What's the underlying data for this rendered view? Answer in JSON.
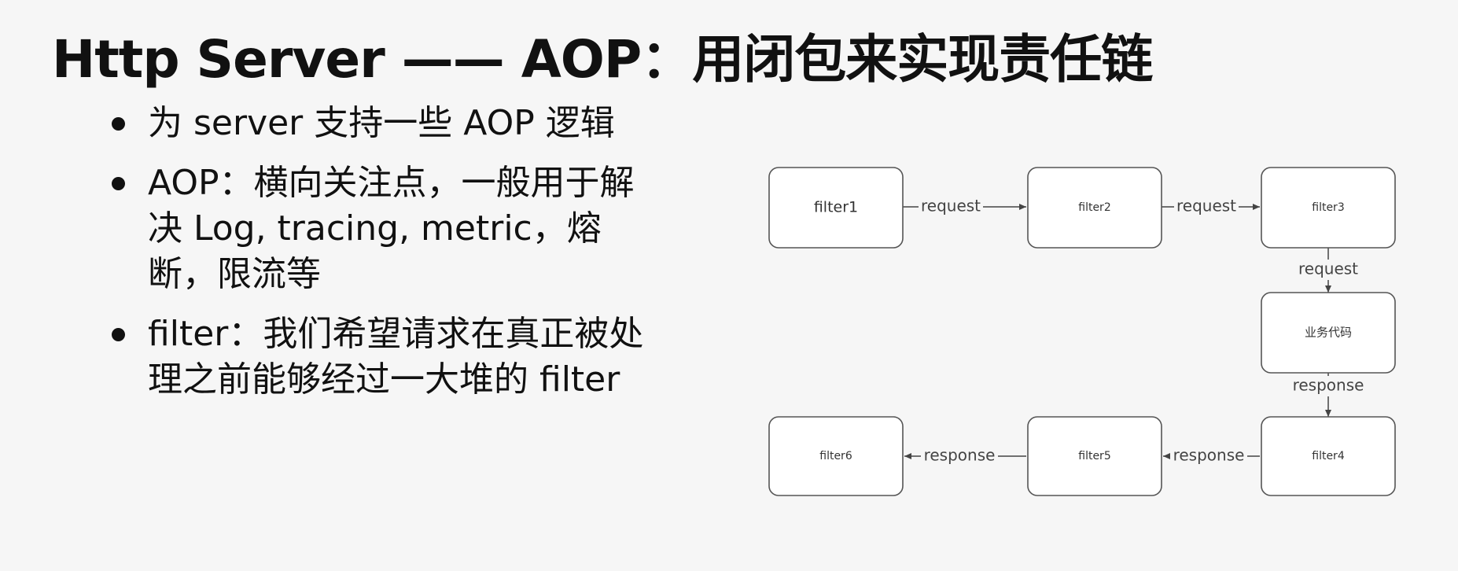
{
  "title": "Http Server —— AOP：用闭包来实现责任链",
  "bullets": [
    "为 server 支持一些 AOP 逻辑",
    "AOP：横向关注点，一般用于解决 Log, tracing, metric，熔断，限流等",
    "filter：我们希望请求在真正被处理之前能够经过一大堆的 filter"
  ],
  "diagram": {
    "nodes": {
      "filter1": "filter1",
      "filter2": "filter2",
      "filter3": "filter3",
      "business": "业务代码",
      "filter4": "filter4",
      "filter5": "filter5",
      "filter6": "filter6"
    },
    "edges": {
      "f1_f2": "request",
      "f2_f3": "request",
      "f3_biz": "request",
      "biz_f4": "response",
      "f4_f5": "response",
      "f5_f6": "response"
    }
  }
}
